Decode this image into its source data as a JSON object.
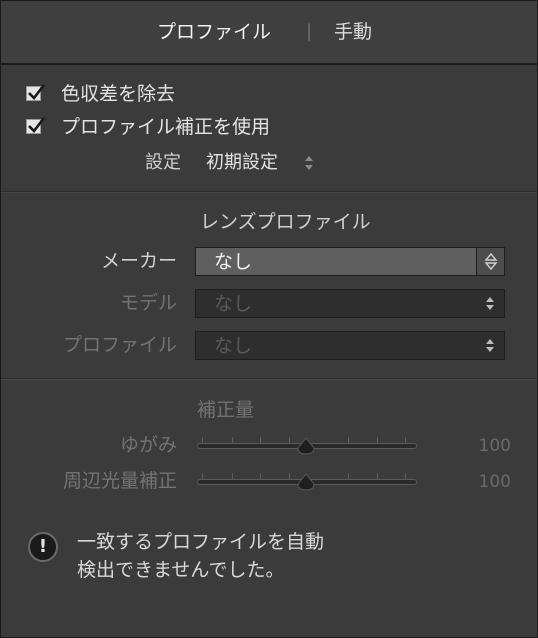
{
  "header": {
    "tab_profile": "プロファイル",
    "separator": "|",
    "tab_manual": "手動"
  },
  "options": {
    "remove_ca": {
      "label": "色収差を除去",
      "checked": true
    },
    "enable_profile": {
      "label": "プロファイル補正を使用",
      "checked": true
    },
    "setting_label": "設定",
    "setting_value": "初期設定"
  },
  "lens_profile": {
    "title": "レンズプロファイル",
    "maker_label": "メーカー",
    "maker_value": "なし",
    "model_label": "モデル",
    "model_value": "なし",
    "profile_label": "プロファイル",
    "profile_value": "なし"
  },
  "amount": {
    "title": "補正量",
    "distortion_label": "ゆがみ",
    "distortion_value": "100",
    "vignetting_label": "周辺光量補正",
    "vignetting_value": "100"
  },
  "warning": {
    "icon": "exclamation-icon",
    "line1": "一致するプロファイルを自動",
    "line2": "検出できませんでした。"
  }
}
